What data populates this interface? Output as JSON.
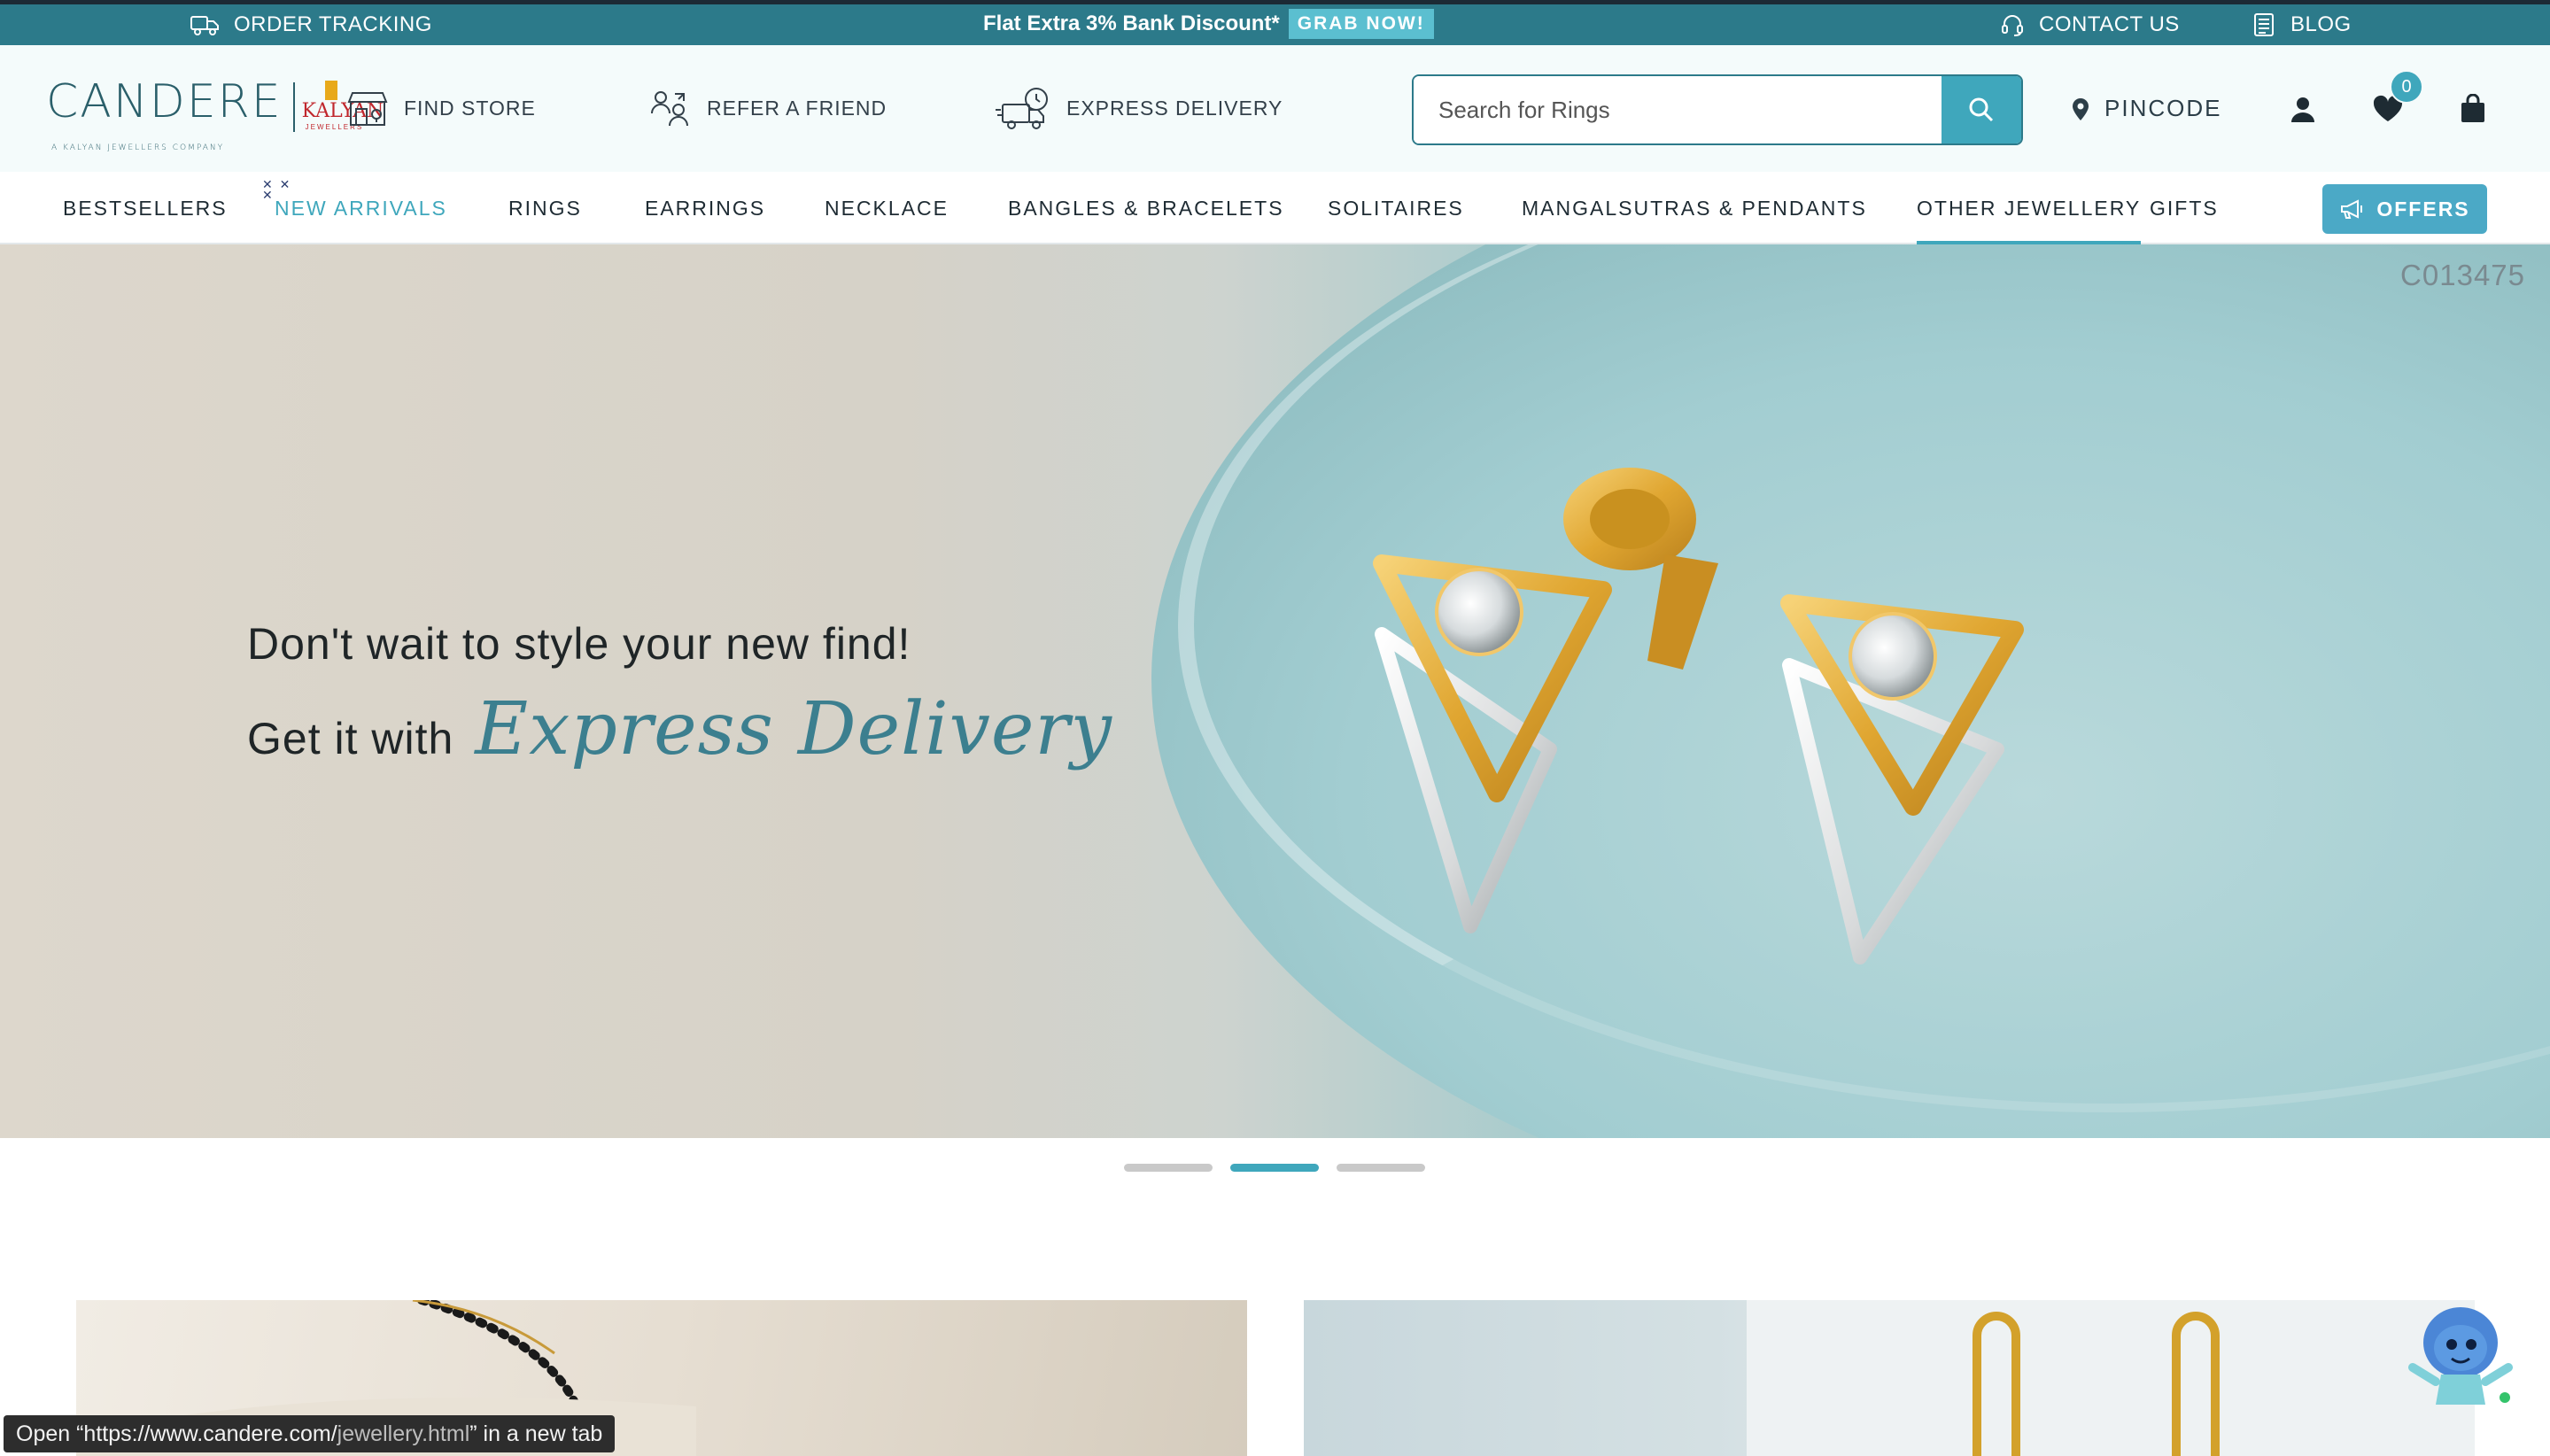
{
  "topbar": {
    "order_tracking": "ORDER TRACKING",
    "promo_text": "Flat Extra 3% Bank Discount*",
    "promo_button": "GRAB NOW!",
    "contact_us": "CONTACT US",
    "blog": "BLOG"
  },
  "header": {
    "logo_text": "CANDERE",
    "logo_tagline": "A KALYAN JEWELLERS COMPANY",
    "partner_logo_name": "KALYAN",
    "partner_logo_sub": "JEWELLERS",
    "find_store": "FIND STORE",
    "refer_a_friend": "REFER A FRIEND",
    "express_delivery": "EXPRESS DELIVERY",
    "search_placeholder": "Search for Rings",
    "pincode": "PINCODE",
    "wishlist_count": "0"
  },
  "nav": {
    "items": [
      "BESTSELLERS",
      "NEW ARRIVALS",
      "RINGS",
      "EARRINGS",
      "NECKLACE",
      "BANGLES & BRACELETS",
      "SOLITAIRES",
      "MANGALSUTRAS & PENDANTS",
      "OTHER JEWELLERY",
      "GIFTS"
    ],
    "offers": "OFFERS"
  },
  "hero": {
    "code": "C013475",
    "line1": "Don't wait to style your new find!",
    "line2_prefix": "Get it with",
    "line2_script": "Express Delivery"
  },
  "slider": {
    "count": 3,
    "active": 2
  },
  "status_bar": {
    "prefix": "Open “https://www.candere.com/",
    "path": "jewellery.html",
    "suffix": "” in a new tab"
  },
  "colors": {
    "topbar": "#2c7a8a",
    "accent": "#3fa7bc",
    "header_bg": "#f4fbfb"
  },
  "icons": {
    "order_tracking": "truck-icon",
    "contact_us": "headset-icon",
    "blog": "document-icon",
    "find_store": "store-icon",
    "refer": "people-icon",
    "express": "fast-truck-icon",
    "search": "search-icon",
    "pincode": "location-pin-icon",
    "account": "user-icon",
    "wishlist": "heart-icon",
    "cart": "shopping-bag-icon",
    "offers": "megaphone-icon"
  }
}
